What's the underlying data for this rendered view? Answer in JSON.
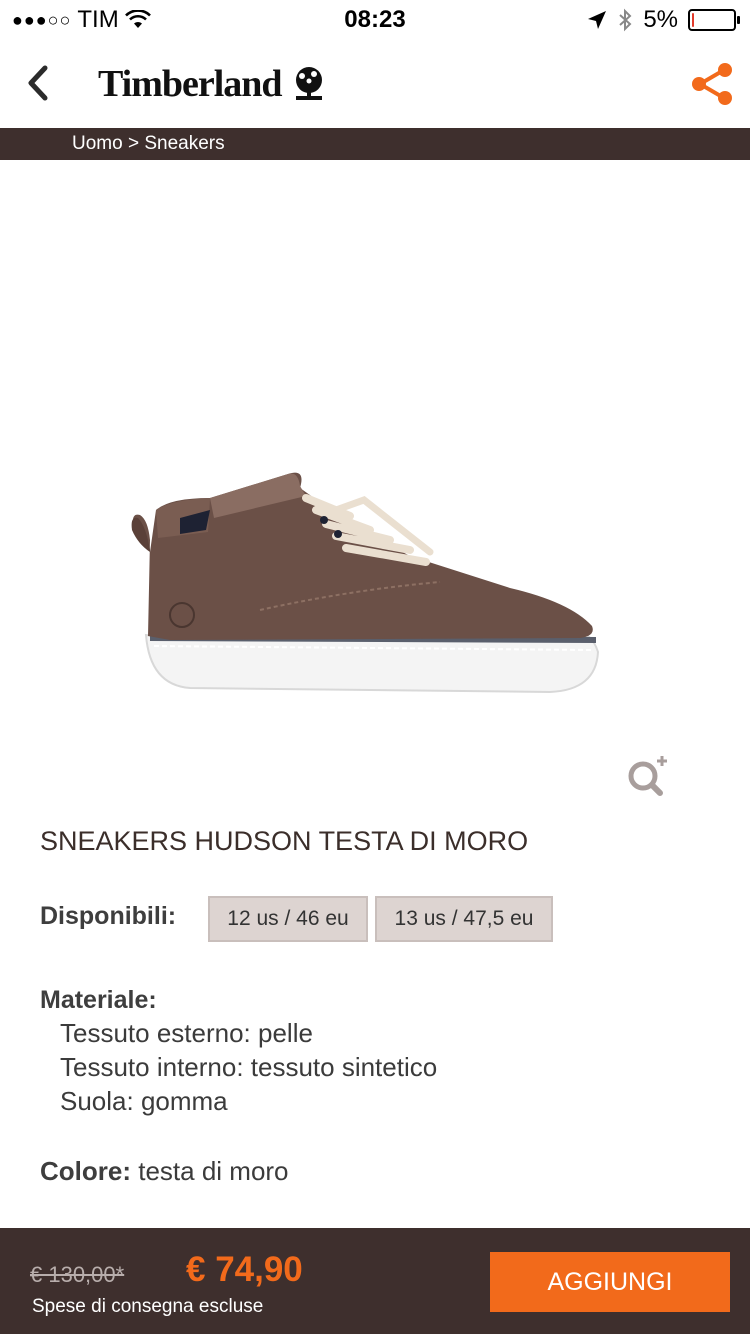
{
  "status_bar": {
    "signal_dots": "●●●○○",
    "carrier": "TIM",
    "wifi_icon": "wifi-icon",
    "time": "08:23",
    "location_icon": "location-arrow-icon",
    "bluetooth_icon": "bluetooth-icon",
    "battery_percent": "5%",
    "battery_level": 0.05
  },
  "header": {
    "back_icon": "chevron-left-icon",
    "brand": "Timberland",
    "brand_icon": "tree-logo-icon",
    "share_icon": "share-icon",
    "accent_color": "#f26a1b"
  },
  "breadcrumb": {
    "path": "Uomo > Sneakers"
  },
  "product": {
    "image_icon": "sneaker-image",
    "zoom_icon": "zoom-plus-icon",
    "title": "SNEAKERS HUDSON TESTA DI MORO",
    "availability_label": "Disponibili:",
    "sizes": [
      "12 us / 46 eu",
      "13 us / 47,5 eu"
    ],
    "material_label": "Materiale:",
    "materials": [
      "Tessuto esterno: pelle",
      "Tessuto interno: tessuto sintetico",
      "Suola: gomma"
    ],
    "color_label": "Colore:",
    "color_value": "testa di moro"
  },
  "purchase_bar": {
    "old_price": "€ 130,00*",
    "new_price": "€ 74,90",
    "shipping_note": "Spese di consegna escluse",
    "add_button": "AGGIUNGI",
    "bar_color": "#3e2f2d"
  }
}
